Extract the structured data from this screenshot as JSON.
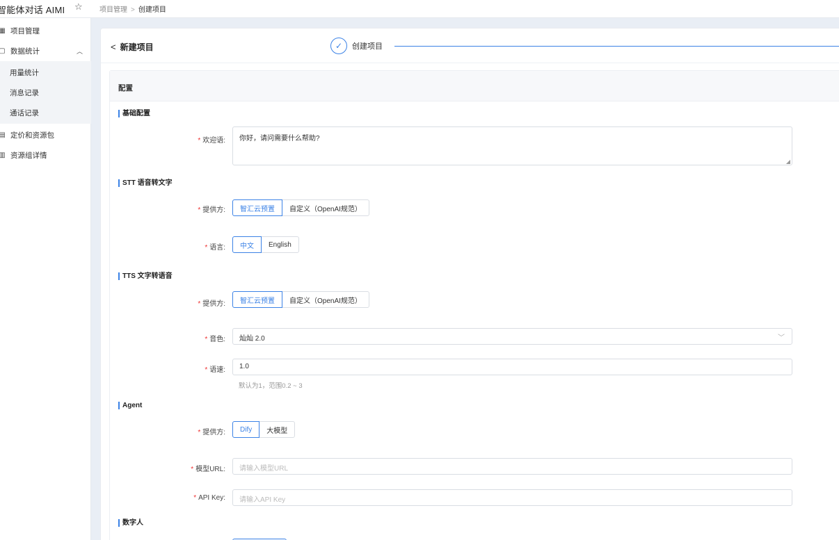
{
  "app": {
    "title": "智能体对话 AIMI"
  },
  "breadcrumb": {
    "parent": "项目管理",
    "separator": ">",
    "current": "创建项目"
  },
  "sidebar": {
    "items": [
      {
        "label": "项目管理",
        "icon": "grid-icon"
      },
      {
        "label": "数据统计",
        "icon": "chat-icon"
      },
      {
        "label": "定价和资源包",
        "icon": "tag-icon"
      },
      {
        "label": "资源组详情",
        "icon": "building-icon"
      }
    ],
    "subitems": [
      {
        "label": "用量统计"
      },
      {
        "label": "消息记录"
      },
      {
        "label": "通话记录"
      }
    ]
  },
  "header": {
    "back_label": "新建项目",
    "step_label": "创建项目"
  },
  "section": {
    "title": "配置"
  },
  "groups": {
    "basic": {
      "title": "基础配置",
      "welcome_label": "欢迎语:",
      "welcome_value": "你好，请问需要什么帮助?"
    },
    "stt": {
      "title": "STT 语音转文字",
      "provider_label": "提供方:",
      "provider_options": [
        "智汇云预置",
        "自定义（OpenAI规范）"
      ],
      "language_label": "语言:",
      "language_options": [
        "中文",
        "English"
      ]
    },
    "tts": {
      "title": "TTS 文字转语音",
      "provider_label": "提供方:",
      "provider_options": [
        "智汇云预置",
        "自定义（OpenAI规范）"
      ],
      "voice_label": "音色:",
      "voice_value": "灿灿 2.0",
      "speed_label": "语速:",
      "speed_value": "1.0",
      "speed_hint": "默认为1，范围0.2 ~ 3"
    },
    "agent": {
      "title": "Agent",
      "provider_label": "提供方:",
      "provider_options": [
        "Dify",
        "大模型"
      ],
      "model_url_label": "模型URL:",
      "model_url_placeholder": "请输入模型URL",
      "api_key_label": "API Key:",
      "api_key_placeholder": "请输入API Key"
    },
    "digital_human": {
      "title": "数字人"
    }
  },
  "colors": {
    "accent": "#3b82e6",
    "required": "#e33333"
  }
}
